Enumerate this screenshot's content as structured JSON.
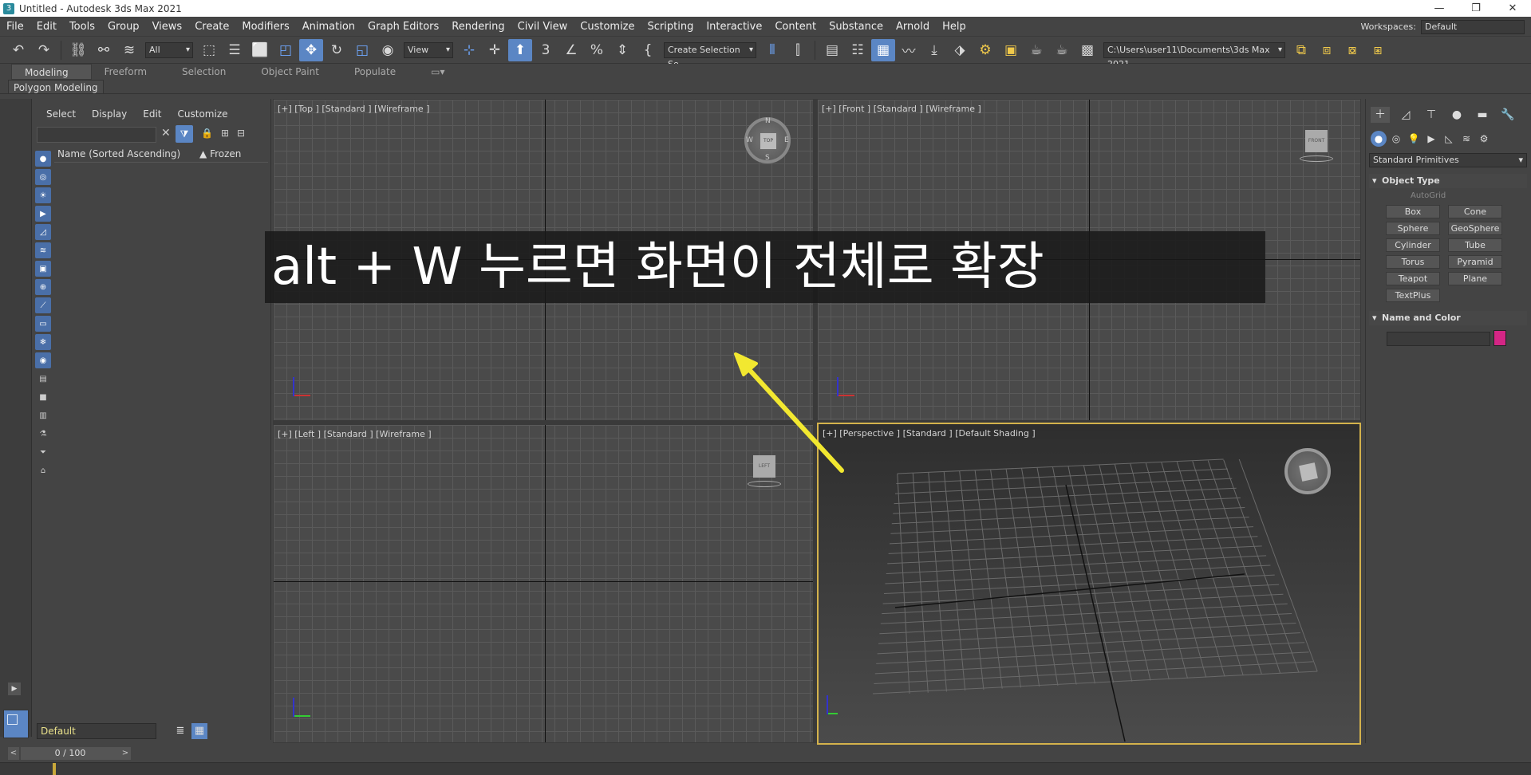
{
  "window": {
    "title": "Untitled - Autodesk 3ds Max 2021",
    "app_icon": "3",
    "controls": [
      "—",
      "❐",
      "✕"
    ]
  },
  "menu": [
    "File",
    "Edit",
    "Tools",
    "Group",
    "Views",
    "Create",
    "Modifiers",
    "Animation",
    "Graph Editors",
    "Rendering",
    "Civil View",
    "Customize",
    "Scripting",
    "Interactive",
    "Content",
    "Substance",
    "Arnold",
    "Help"
  ],
  "workspaces": {
    "label": "Workspaces:",
    "value": "Default"
  },
  "toolbar": {
    "selection_filter": "All",
    "ref_coord": "View",
    "named_selection": "Create Selection Se",
    "project_path": "C:\\Users\\user11\\Documents\\3ds Max 2021"
  },
  "ribbon": {
    "tabs": [
      "Modeling",
      "Freeform",
      "Selection",
      "Object Paint",
      "Populate"
    ],
    "sub": "Polygon Modeling"
  },
  "scene_explorer": {
    "menu": [
      "Select",
      "Display",
      "Edit",
      "Customize"
    ],
    "columns": {
      "name": "Name (Sorted Ascending)",
      "sort_indicator": "▲",
      "frozen": "Frozen"
    },
    "layer": "Default"
  },
  "viewports": [
    {
      "label": "[+] [Top ] [Standard ] [Wireframe ]"
    },
    {
      "label": "[+] [Front ] [Standard ] [Wireframe ]"
    },
    {
      "label": "[+] [Left ] [Standard ] [Wireframe ]"
    },
    {
      "label": "[+] [Perspective ] [Standard ] [Default Shading ]"
    }
  ],
  "viewcube": {
    "top": "TOP",
    "front": "FRONT",
    "left": "LEFT",
    "dirs": {
      "n": "N",
      "s": "S",
      "e": "E",
      "w": "W"
    }
  },
  "overlay_caption": "alt + W 누르면 화면이 전체로 확장",
  "command_panel": {
    "dropdown": "Standard Primitives",
    "object_type": "Object Type",
    "autogrid": "AutoGrid",
    "buttons": [
      "Box",
      "Cone",
      "Sphere",
      "GeoSphere",
      "Cylinder",
      "Tube",
      "Torus",
      "Pyramid",
      "Teapot",
      "Plane",
      "TextPlus"
    ],
    "name_and_color": "Name and Color",
    "object_color": "#d42685"
  },
  "timeline": {
    "frame": "0 / 100",
    "prev": "<",
    "next": ">"
  },
  "colors": {
    "accent": "#5b86c4",
    "active_viewport": "#d4b24c",
    "arrow": "#f2e830"
  }
}
